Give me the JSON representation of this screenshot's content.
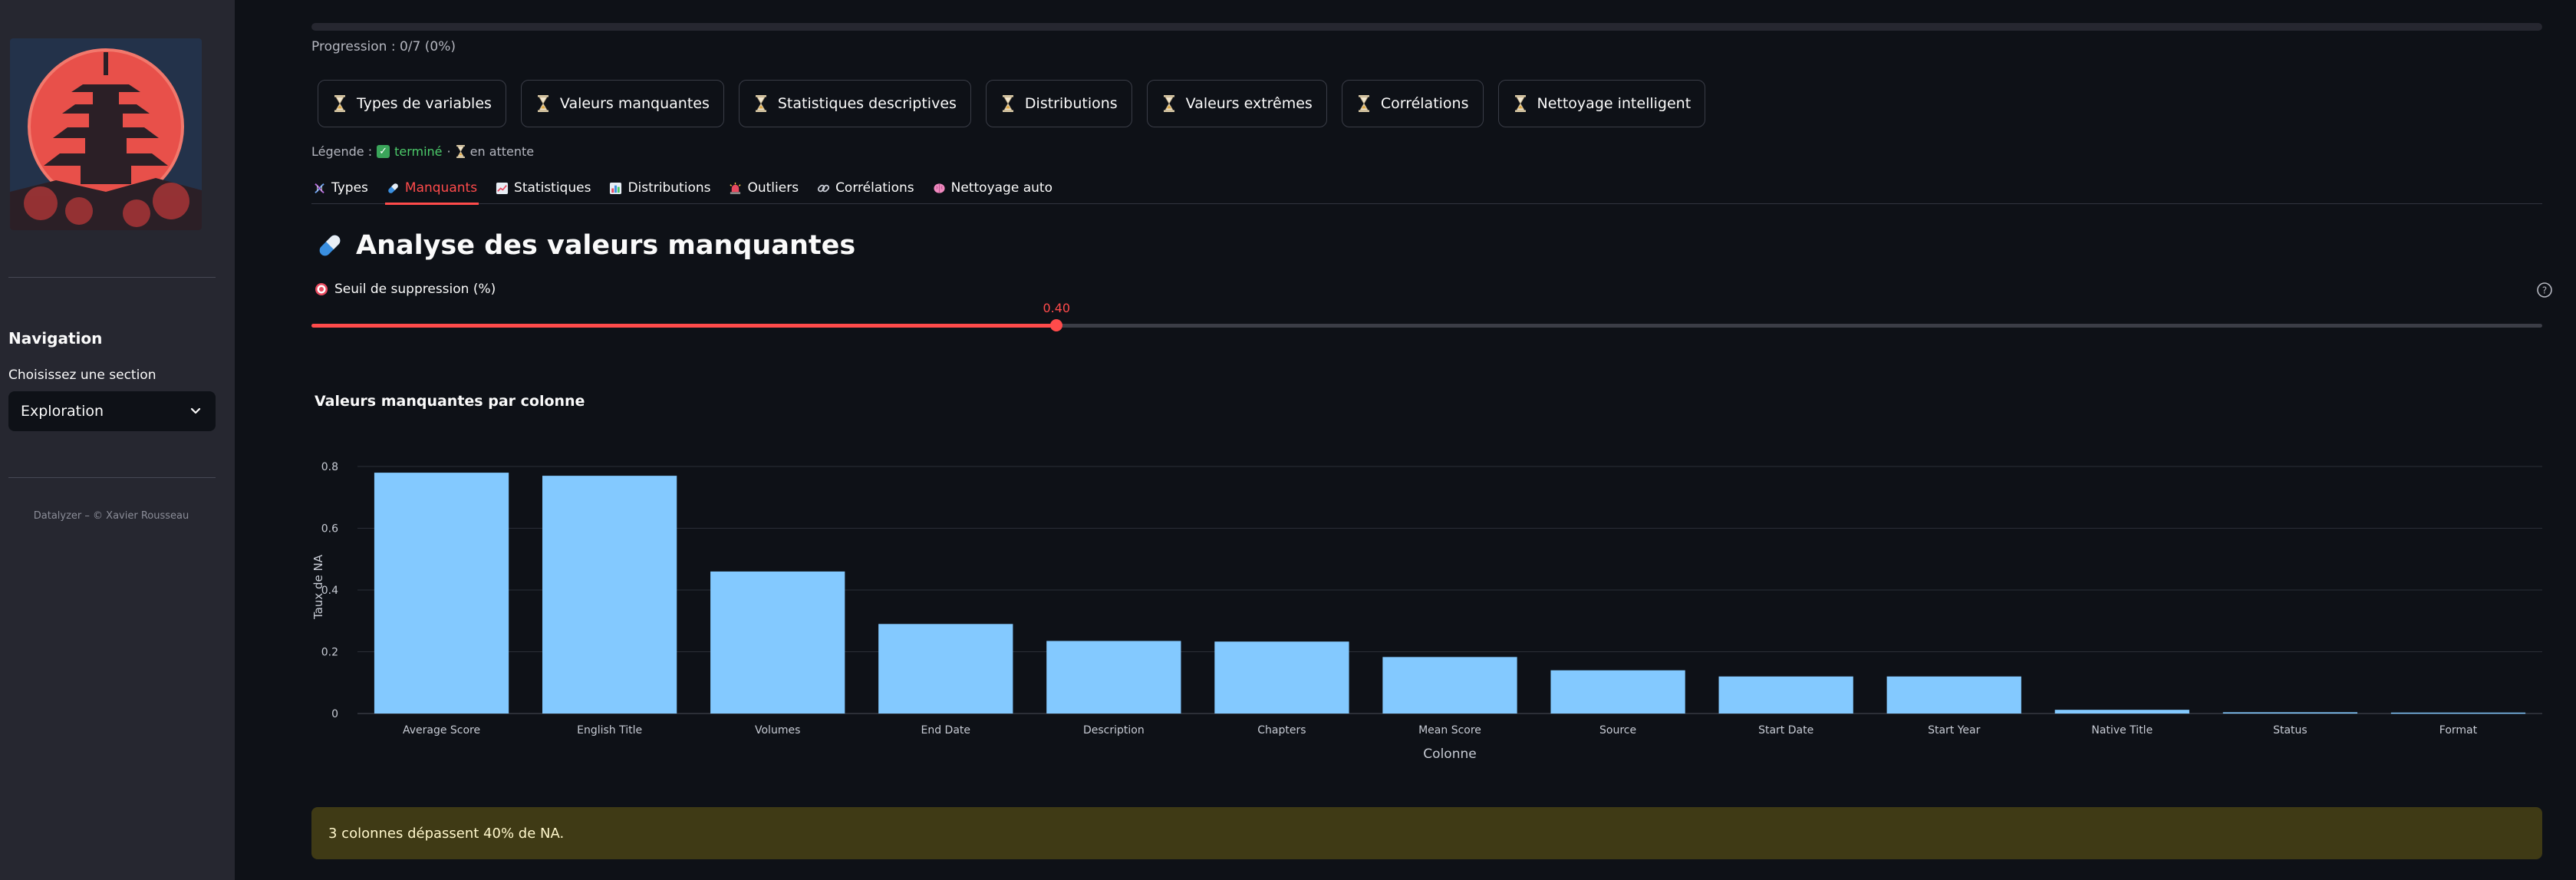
{
  "sidebar": {
    "nav_title": "Navigation",
    "select_label": "Choisissez une section",
    "select_value": "Exploration",
    "footer": "Datalyzer – © Xavier Rousseau"
  },
  "progress": {
    "text": "Progression : 0/7 (0%)",
    "fraction": 0
  },
  "steps": [
    "Types de variables",
    "Valeurs manquantes",
    "Statistiques descriptives",
    "Distributions",
    "Valeurs extrêmes",
    "Corrélations",
    "Nettoyage intelligent"
  ],
  "legend": {
    "prefix": "Légende :",
    "done": "terminé",
    "sep": "·",
    "pending": "en attente"
  },
  "tabs": [
    {
      "label": "Types",
      "icon": "dna-icon"
    },
    {
      "label": "Manquants",
      "icon": "pill-icon"
    },
    {
      "label": "Statistiques",
      "icon": "chart-up-icon"
    },
    {
      "label": "Distributions",
      "icon": "bar-chart-icon"
    },
    {
      "label": "Outliers",
      "icon": "siren-icon"
    },
    {
      "label": "Corrélations",
      "icon": "link-icon"
    },
    {
      "label": "Nettoyage auto",
      "icon": "brain-icon"
    }
  ],
  "active_tab": 1,
  "section": {
    "title": "Analyse des valeurs manquantes",
    "icon": "pill-icon"
  },
  "slider": {
    "label": "Seuil de suppression (%)",
    "value": 0.4,
    "value_text": "0.40",
    "min": 0,
    "max": 1,
    "icon": "target-icon"
  },
  "colors": {
    "accent": "#ff4b4b",
    "bar": "#83c9ff",
    "sidebar": "#262730",
    "background": "#0e1117"
  },
  "chart_title": "Valeurs manquantes par colonne",
  "chart_data": {
    "type": "bar",
    "title": "Valeurs manquantes par colonne",
    "xlabel": "Colonne",
    "ylabel": "Taux de NA",
    "categories": [
      "Average Score",
      "English Title",
      "Volumes",
      "End Date",
      "Description",
      "Chapters",
      "Mean Score",
      "Source",
      "Start Date",
      "Start Year",
      "Native Title",
      "Status",
      "Format"
    ],
    "values": [
      0.78,
      0.77,
      0.46,
      0.29,
      0.235,
      0.233,
      0.183,
      0.14,
      0.12,
      0.12,
      0.012,
      0.004,
      0.003
    ],
    "yticks": [
      "0",
      "0.2",
      "0.4",
      "0.6",
      "0.8"
    ],
    "ylim": [
      0,
      0.82
    ],
    "grid": true
  },
  "alert": "3 colonnes dépassent 40% de NA."
}
